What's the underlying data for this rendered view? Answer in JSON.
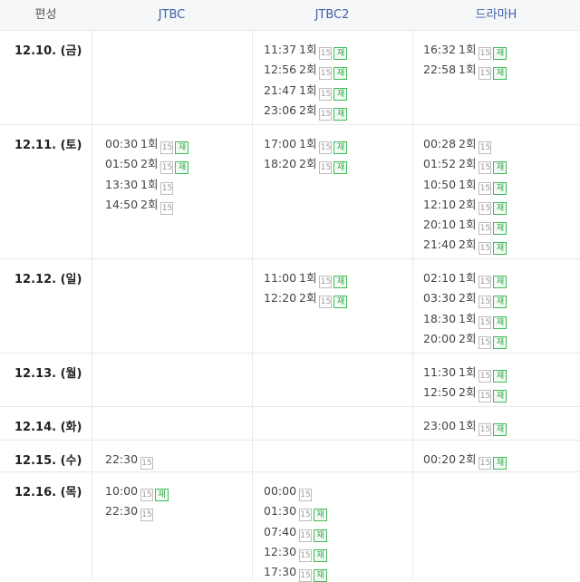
{
  "header": {
    "day_col": "편성",
    "channels": [
      "JTBC",
      "JTBC2",
      "드라마H"
    ]
  },
  "badges": {
    "rating": "15",
    "rerun": "재"
  },
  "days": [
    {
      "date": "12.10. (금)",
      "channels": [
        [],
        [
          {
            "time": "11:37",
            "ep": "1회",
            "rerun": true
          },
          {
            "time": "12:56",
            "ep": "2회",
            "rerun": true
          },
          {
            "time": "21:47",
            "ep": "1회",
            "rerun": true
          },
          {
            "time": "23:06",
            "ep": "2회",
            "rerun": true
          }
        ],
        [
          {
            "time": "16:32",
            "ep": "1회",
            "rerun": true
          },
          {
            "time": "22:58",
            "ep": "1회",
            "rerun": true
          }
        ]
      ]
    },
    {
      "date": "12.11. (토)",
      "channels": [
        [
          {
            "time": "00:30",
            "ep": "1회",
            "rerun": true
          },
          {
            "time": "01:50",
            "ep": "2회",
            "rerun": true
          },
          {
            "time": "13:30",
            "ep": "1회",
            "rerun": false
          },
          {
            "time": "14:50",
            "ep": "2회",
            "rerun": false
          }
        ],
        [
          {
            "time": "17:00",
            "ep": "1회",
            "rerun": true
          },
          {
            "time": "18:20",
            "ep": "2회",
            "rerun": true
          }
        ],
        [
          {
            "time": "00:28",
            "ep": "2회",
            "rerun": false
          },
          {
            "time": "01:52",
            "ep": "2회",
            "rerun": true
          },
          {
            "time": "10:50",
            "ep": "1회",
            "rerun": true
          },
          {
            "time": "12:10",
            "ep": "2회",
            "rerun": true
          },
          {
            "time": "20:10",
            "ep": "1회",
            "rerun": true
          },
          {
            "time": "21:40",
            "ep": "2회",
            "rerun": true
          }
        ]
      ]
    },
    {
      "date": "12.12. (일)",
      "channels": [
        [],
        [
          {
            "time": "11:00",
            "ep": "1회",
            "rerun": true
          },
          {
            "time": "12:20",
            "ep": "2회",
            "rerun": true
          }
        ],
        [
          {
            "time": "02:10",
            "ep": "1회",
            "rerun": true
          },
          {
            "time": "03:30",
            "ep": "2회",
            "rerun": true
          },
          {
            "time": "18:30",
            "ep": "1회",
            "rerun": true
          },
          {
            "time": "20:00",
            "ep": "2회",
            "rerun": true
          }
        ]
      ]
    },
    {
      "date": "12.13. (월)",
      "channels": [
        [],
        [],
        [
          {
            "time": "11:30",
            "ep": "1회",
            "rerun": true
          },
          {
            "time": "12:50",
            "ep": "2회",
            "rerun": true
          }
        ]
      ]
    },
    {
      "date": "12.14. (화)",
      "channels": [
        [],
        [],
        [
          {
            "time": "23:00",
            "ep": "1회",
            "rerun": true
          }
        ]
      ]
    },
    {
      "date": "12.15. (수)",
      "channels": [
        [
          {
            "time": "22:30",
            "ep": "",
            "rerun": false
          }
        ],
        [],
        [
          {
            "time": "00:20",
            "ep": "2회",
            "rerun": true
          }
        ]
      ]
    },
    {
      "date": "12.16. (목)",
      "channels": [
        [
          {
            "time": "10:00",
            "ep": "",
            "rerun": true
          },
          {
            "time": "22:30",
            "ep": "",
            "rerun": false
          }
        ],
        [
          {
            "time": "00:00",
            "ep": "",
            "rerun": false
          },
          {
            "time": "01:30",
            "ep": "",
            "rerun": true
          },
          {
            "time": "07:40",
            "ep": "",
            "rerun": true
          },
          {
            "time": "12:30",
            "ep": "",
            "rerun": true
          },
          {
            "time": "17:30",
            "ep": "",
            "rerun": true
          }
        ],
        []
      ]
    }
  ]
}
